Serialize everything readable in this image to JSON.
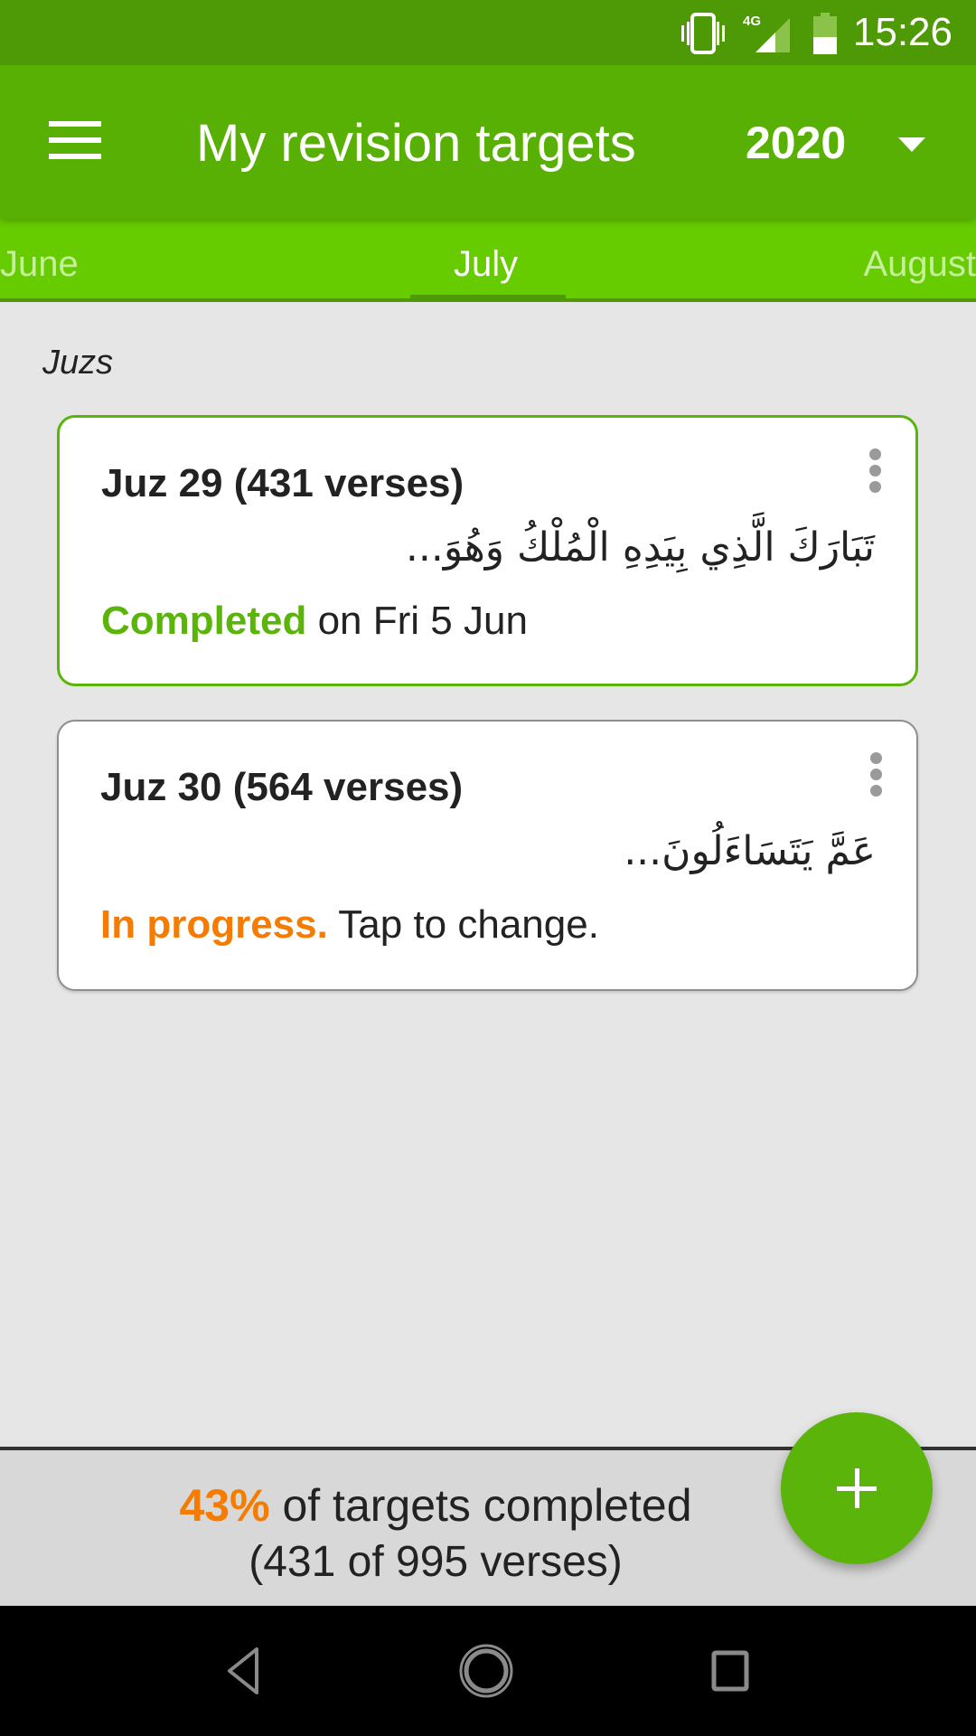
{
  "status_bar": {
    "time": "15:26",
    "network": "4G",
    "icons": [
      "vibrate-icon",
      "signal-4g-icon",
      "battery-icon"
    ]
  },
  "app_bar": {
    "title": "My revision targets",
    "year_selected": "2020",
    "menu_icon": "hamburger-menu-icon",
    "year_dropdown_icon": "caret-down-icon"
  },
  "tabs": {
    "previous": "June",
    "active": "July",
    "next": "August"
  },
  "section": {
    "label": "Juzs"
  },
  "cards": [
    {
      "title": "Juz 29 (431 verses)",
      "arabic": "تَبَارَكَ الَّذِي بِيَدِهِ الْمُلْكُ وَهُوَ...",
      "status_highlight": "Completed",
      "status_text": " on Fri 5 Jun",
      "status_color": "#5bb40a",
      "border_color": "#5bb40a"
    },
    {
      "title": "Juz 30 (564 verses)",
      "arabic": "عَمَّ يَتَسَاءَلُونَ...",
      "status_highlight": "In progress.",
      "status_text": " Tap to change.",
      "status_color": "#f57c00",
      "border_color": "#8f8f8f"
    }
  ],
  "footer": {
    "percent": "43%",
    "summary_text": " of targets completed",
    "detail": "(431 of 995 verses)",
    "percent_color": "#f57c00"
  },
  "fab": {
    "icon": "plus-icon",
    "label": "Add target"
  },
  "colors": {
    "status_bar": "#4e9a06",
    "app_bar": "#58b004",
    "tabs": "#66cc00",
    "accent_green": "#5bb40a",
    "accent_orange": "#f57c00"
  }
}
